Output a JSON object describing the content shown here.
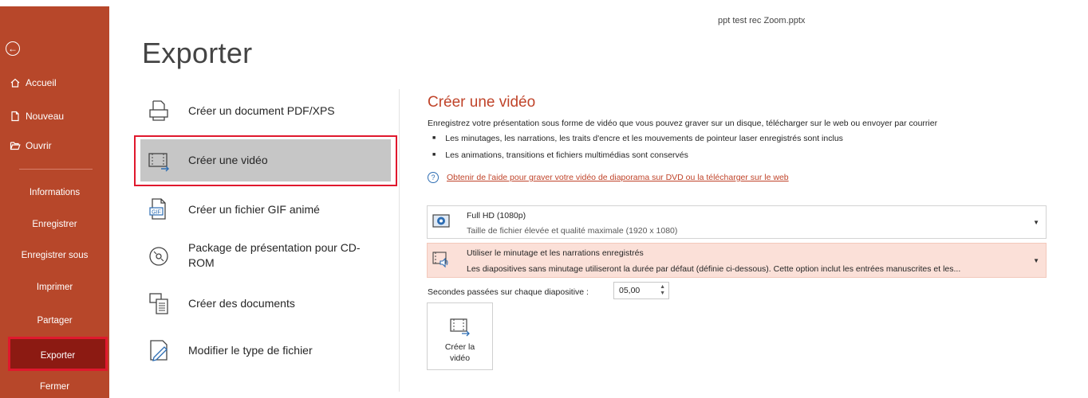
{
  "window": {
    "title": "ppt test rec Zoom.pptx"
  },
  "sidebar": {
    "back_icon": "back-arrow-icon",
    "top_items": [
      {
        "label": "Accueil",
        "icon": "home-icon"
      },
      {
        "label": "Nouveau",
        "icon": "new-document-icon"
      },
      {
        "label": "Ouvrir",
        "icon": "open-folder-icon"
      }
    ],
    "items": [
      {
        "label": "Informations"
      },
      {
        "label": "Enregistrer"
      },
      {
        "label": "Enregistrer sous"
      },
      {
        "label": "Imprimer"
      },
      {
        "label": "Partager"
      },
      {
        "label": "Exporter",
        "selected": true
      },
      {
        "label": "Fermer"
      }
    ],
    "background": "#b7472a",
    "active_background": "#8c1a12"
  },
  "page": {
    "title": "Exporter"
  },
  "export_options": [
    {
      "label": "Créer un document PDF/XPS",
      "icon": "pdf-document-icon"
    },
    {
      "label": "Créer une vidéo",
      "icon": "video-icon",
      "selected": true
    },
    {
      "label": "Créer un fichier GIF animé",
      "icon": "gif-file-icon"
    },
    {
      "label": "Package de présentation pour CD-ROM",
      "icon": "cd-icon"
    },
    {
      "label": "Créer des documents",
      "icon": "handouts-icon"
    },
    {
      "label": "Modifier le type de fichier",
      "icon": "change-file-type-icon"
    }
  ],
  "video_panel": {
    "title": "Créer une vidéo",
    "description": "Enregistrez votre présentation sous forme de vidéo que vous pouvez graver sur un disque, télécharger sur le web ou envoyer par courrier",
    "bullets": [
      "Les minutages, les narrations, les traits d'encre et les mouvements de pointeur laser enregistrés sont inclus",
      "Les animations, transitions et fichiers multimédias sont conservés"
    ],
    "help_link": "Obtenir de l'aide pour graver votre vidéo de diaporama sur DVD ou la télécharger sur le web",
    "quality_dropdown": {
      "title": "Full HD (1080p)",
      "subtitle": "Taille de fichier élevée et qualité maximale (1920 x 1080)"
    },
    "timing_dropdown": {
      "title": "Utiliser le minutage et les narrations enregistrés",
      "subtitle": "Les diapositives sans minutage utiliseront la durée par défaut (définie ci-dessous). Cette option inclut les entrées manuscrites et les..."
    },
    "seconds_label": "Secondes passées sur chaque diapositive :",
    "seconds_value": "05,00",
    "create_button": {
      "line1": "Créer la",
      "line2": "vidéo"
    },
    "accent_color": "#c0442a",
    "highlight_color": "#e0182d"
  }
}
